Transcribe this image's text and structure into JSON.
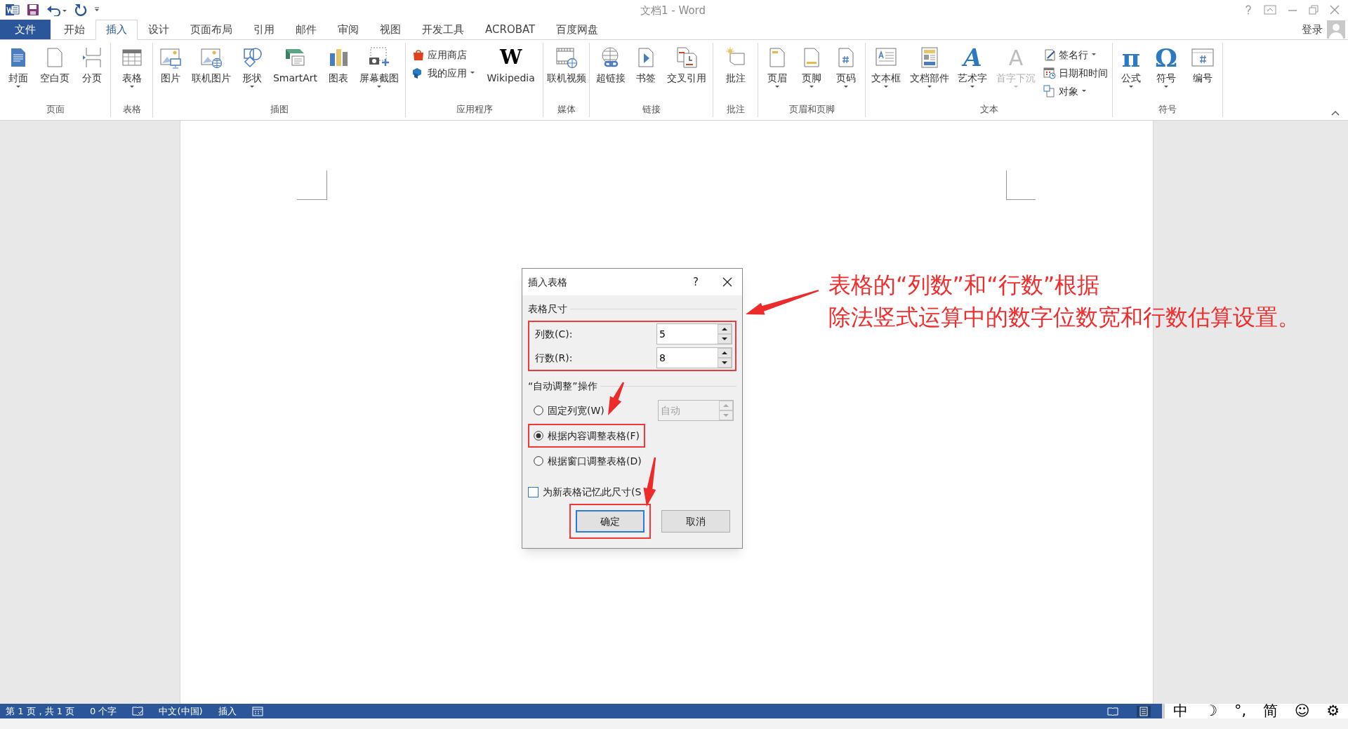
{
  "window": {
    "title": "文档1 - Word",
    "sign_in": "登录"
  },
  "tabs": [
    {
      "label": "文件",
      "kind": "file",
      "selected": false
    },
    {
      "label": "开始",
      "kind": "tab",
      "selected": false
    },
    {
      "label": "插入",
      "kind": "tab",
      "selected": true
    },
    {
      "label": "设计",
      "kind": "tab",
      "selected": false
    },
    {
      "label": "页面布局",
      "kind": "tab",
      "selected": false
    },
    {
      "label": "引用",
      "kind": "tab",
      "selected": false
    },
    {
      "label": "邮件",
      "kind": "tab",
      "selected": false
    },
    {
      "label": "审阅",
      "kind": "tab",
      "selected": false
    },
    {
      "label": "视图",
      "kind": "tab",
      "selected": false
    },
    {
      "label": "开发工具",
      "kind": "tab",
      "selected": false
    },
    {
      "label": "ACROBAT",
      "kind": "tab",
      "selected": false
    },
    {
      "label": "百度网盘",
      "kind": "tab",
      "selected": false
    }
  ],
  "ribbon_groups": [
    {
      "label": "页面",
      "items": [
        {
          "kind": "large",
          "label": "封面",
          "dropdown": true
        },
        {
          "kind": "large",
          "label": "空白页",
          "dropdown": false
        },
        {
          "kind": "large",
          "label": "分页",
          "dropdown": false
        }
      ]
    },
    {
      "label": "表格",
      "items": [
        {
          "kind": "large",
          "label": "表格",
          "dropdown": true
        }
      ]
    },
    {
      "label": "插图",
      "items": [
        {
          "kind": "large",
          "label": "图片",
          "dropdown": false
        },
        {
          "kind": "large",
          "label": "联机图片",
          "dropdown": false
        },
        {
          "kind": "large",
          "label": "形状",
          "dropdown": true
        },
        {
          "kind": "large",
          "label": "SmartArt",
          "dropdown": false
        },
        {
          "kind": "large",
          "label": "图表",
          "dropdown": false
        },
        {
          "kind": "large",
          "label": "屏幕截图",
          "dropdown": true
        }
      ]
    },
    {
      "label": "应用程序",
      "items": [
        {
          "kind": "small",
          "label": "应用商店",
          "dropdown": false
        },
        {
          "kind": "small",
          "label": "我的应用",
          "dropdown": true
        },
        {
          "kind": "large",
          "label": "Wikipedia",
          "dropdown": false,
          "glyph": "W"
        }
      ]
    },
    {
      "label": "媒体",
      "items": [
        {
          "kind": "large",
          "label": "联机视频",
          "dropdown": false
        }
      ]
    },
    {
      "label": "链接",
      "items": [
        {
          "kind": "large",
          "label": "超链接",
          "dropdown": false
        },
        {
          "kind": "large",
          "label": "书签",
          "dropdown": false
        },
        {
          "kind": "large",
          "label": "交叉引用",
          "dropdown": false
        }
      ]
    },
    {
      "label": "批注",
      "items": [
        {
          "kind": "large",
          "label": "批注",
          "dropdown": false
        }
      ]
    },
    {
      "label": "页眉和页脚",
      "items": [
        {
          "kind": "large",
          "label": "页眉",
          "dropdown": true
        },
        {
          "kind": "large",
          "label": "页脚",
          "dropdown": true
        },
        {
          "kind": "large",
          "label": "页码",
          "dropdown": true
        }
      ]
    },
    {
      "label": "文本",
      "items": [
        {
          "kind": "large",
          "label": "文本框",
          "dropdown": true
        },
        {
          "kind": "large",
          "label": "文档部件",
          "dropdown": true
        },
        {
          "kind": "large",
          "label": "艺术字",
          "dropdown": true,
          "glyph": "A"
        },
        {
          "kind": "large",
          "label": "首字下沉",
          "dropdown": true,
          "glyph": "A",
          "disabled": true
        },
        {
          "kind": "small",
          "label": "签名行",
          "dropdown": true
        },
        {
          "kind": "small",
          "label": "日期和时间",
          "dropdown": false
        },
        {
          "kind": "small",
          "label": "对象",
          "dropdown": true
        }
      ]
    },
    {
      "label": "符号",
      "items": [
        {
          "kind": "large",
          "label": "公式",
          "dropdown": true,
          "glyph": "π"
        },
        {
          "kind": "large",
          "label": "符号",
          "dropdown": true,
          "glyph": "Ω"
        },
        {
          "kind": "large",
          "label": "编号",
          "dropdown": false
        }
      ]
    }
  ],
  "dialog": {
    "title": "插入表格",
    "help": "?",
    "size_section": "表格尺寸",
    "size_highlighted": true,
    "fields": [
      {
        "label": "列数(C):",
        "value": "5"
      },
      {
        "label": "行数(R):",
        "value": "8"
      }
    ],
    "autofit_section": "“自动调整”操作",
    "options": [
      {
        "label": "固定列宽(W)",
        "selected": false,
        "highlighted": false,
        "width_value": "自动"
      },
      {
        "label": "根据内容调整表格(F)",
        "selected": true,
        "highlighted": true
      },
      {
        "label": "根据窗口调整表格(D)",
        "selected": false,
        "highlighted": false
      }
    ],
    "remember": {
      "label": "为新表格记忆此尺寸(S",
      "checked": false
    },
    "buttons": [
      {
        "label": "确定",
        "default": true,
        "highlighted": true
      },
      {
        "label": "取消",
        "default": false,
        "highlighted": false
      }
    ]
  },
  "annotation": [
    "表格的“列数”和“行数”根据",
    "除法竖式运算中的数字位数宽和行数估算设置。"
  ],
  "status_bar": {
    "items": [
      {
        "kind": "text",
        "text": "第 1 页，共 1 页"
      },
      {
        "kind": "text",
        "text": "0 个字"
      },
      {
        "kind": "icon"
      },
      {
        "kind": "text",
        "text": "中文(中国)"
      },
      {
        "kind": "text",
        "text": "插入"
      },
      {
        "kind": "icon"
      }
    ],
    "ime": [
      "中",
      "☽",
      "°,",
      "简",
      "☺",
      "⚙"
    ]
  }
}
